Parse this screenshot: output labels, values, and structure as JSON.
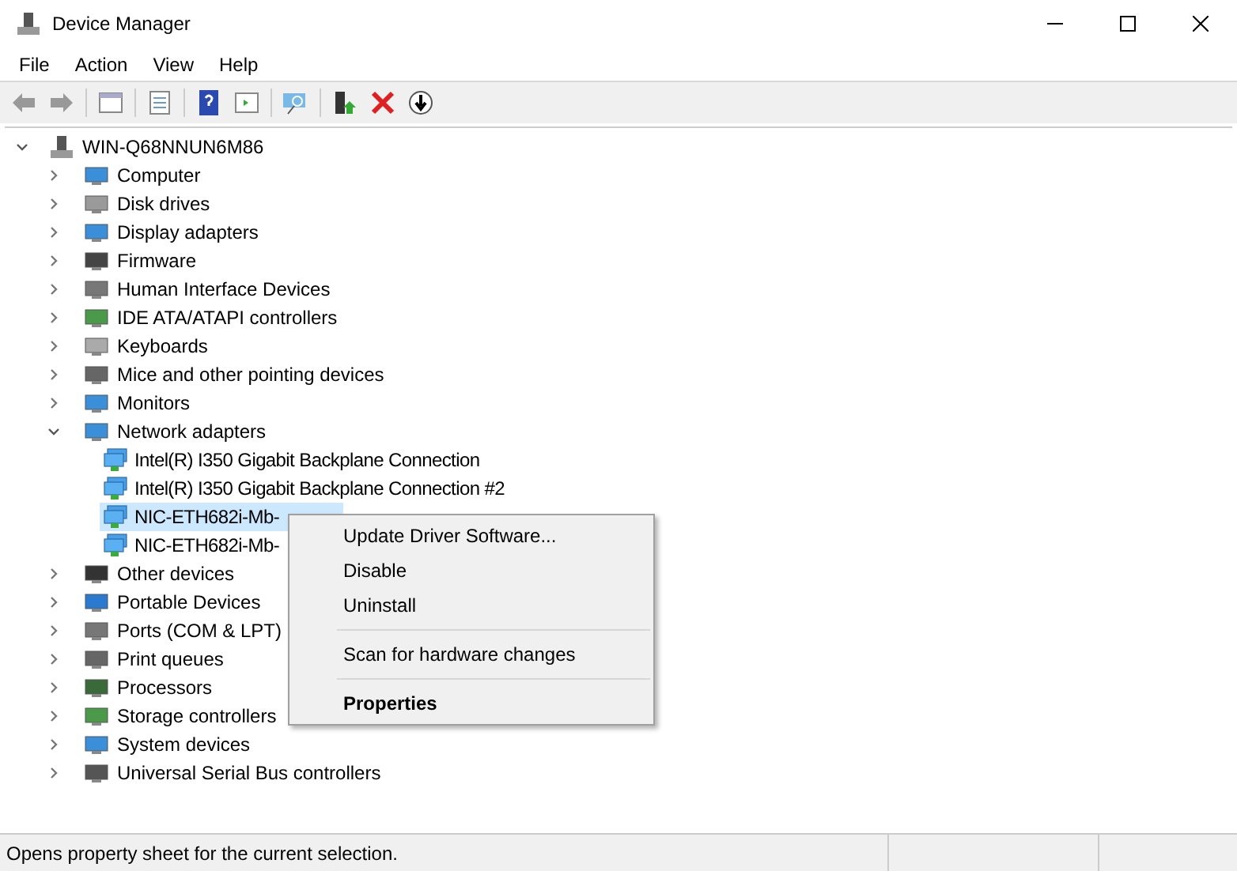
{
  "window": {
    "title": "Device Manager"
  },
  "menu_bar": [
    "File",
    "Action",
    "View",
    "Help"
  ],
  "tree": {
    "label": "WIN-Q68NNUN6M86",
    "expanded": true,
    "children": [
      {
        "label": "Computer",
        "expanded": false
      },
      {
        "label": "Disk drives",
        "expanded": false
      },
      {
        "label": "Display adapters",
        "expanded": false
      },
      {
        "label": "Firmware",
        "expanded": false
      },
      {
        "label": "Human Interface Devices",
        "expanded": false
      },
      {
        "label": "IDE ATA/ATAPI controllers",
        "expanded": false
      },
      {
        "label": "Keyboards",
        "expanded": false
      },
      {
        "label": "Mice and other pointing devices",
        "expanded": false
      },
      {
        "label": "Monitors",
        "expanded": false
      },
      {
        "label": "Network adapters",
        "expanded": true,
        "children": [
          {
            "label": "Intel(R) I350 Gigabit Backplane Connection",
            "selected": false
          },
          {
            "label": "Intel(R) I350 Gigabit Backplane Connection #2",
            "selected": false
          },
          {
            "label": "NIC-ETH682i-Mb-",
            "selected": true
          },
          {
            "label": "NIC-ETH682i-Mb-",
            "selected": false
          }
        ]
      },
      {
        "label": "Other devices",
        "expanded": false
      },
      {
        "label": "Portable Devices",
        "expanded": false
      },
      {
        "label": "Ports (COM & LPT)",
        "expanded": false
      },
      {
        "label": "Print queues",
        "expanded": false
      },
      {
        "label": "Processors",
        "expanded": false
      },
      {
        "label": "Storage controllers",
        "expanded": false
      },
      {
        "label": "System devices",
        "expanded": false
      },
      {
        "label": "Universal Serial Bus controllers",
        "expanded": false
      }
    ]
  },
  "context_menu": [
    {
      "kind": "item",
      "label": "Update Driver Software..."
    },
    {
      "kind": "item",
      "label": "Disable"
    },
    {
      "kind": "item",
      "label": "Uninstall"
    },
    {
      "kind": "separator"
    },
    {
      "kind": "item",
      "label": "Scan for hardware changes"
    },
    {
      "kind": "separator"
    },
    {
      "kind": "default",
      "label": "Properties"
    }
  ],
  "status_bar": "Opens property sheet for the current selection."
}
